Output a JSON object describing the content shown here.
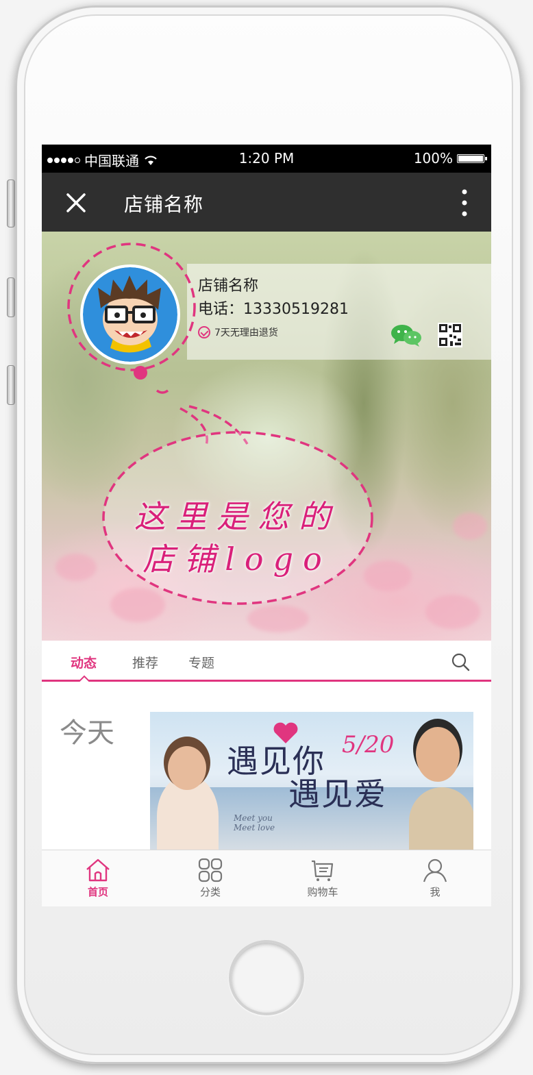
{
  "status_bar": {
    "carrier": "中国联通",
    "time": "1:20 PM",
    "battery": "100%"
  },
  "nav_bar": {
    "title": "店铺名称"
  },
  "shop": {
    "name": "店铺名称",
    "phone": "电话：13330519281",
    "badge": "7天无理由退货"
  },
  "hero": {
    "logo_caption_line1": "这里是您的",
    "logo_caption_line2": "店铺logo"
  },
  "tabs": [
    {
      "label": "动态",
      "active": true
    },
    {
      "label": "推荐",
      "active": false
    },
    {
      "label": "专题",
      "active": false
    }
  ],
  "feed": {
    "day": "今天",
    "banner": {
      "line1": "遇见你",
      "line2": "遇见爱",
      "date": "5/20",
      "sub1": "Meet you",
      "sub2": "Meet love"
    }
  },
  "bottom_nav": [
    {
      "label": "首页",
      "icon": "home-icon",
      "active": true
    },
    {
      "label": "分类",
      "icon": "category-grid-icon",
      "active": false
    },
    {
      "label": "购物车",
      "icon": "cart-icon",
      "active": false
    },
    {
      "label": "我",
      "icon": "profile-icon",
      "active": false
    }
  ],
  "colors": {
    "accent": "#e0357f",
    "nav_bg": "#2f2f2f",
    "wechat_green": "#3fb34a"
  }
}
